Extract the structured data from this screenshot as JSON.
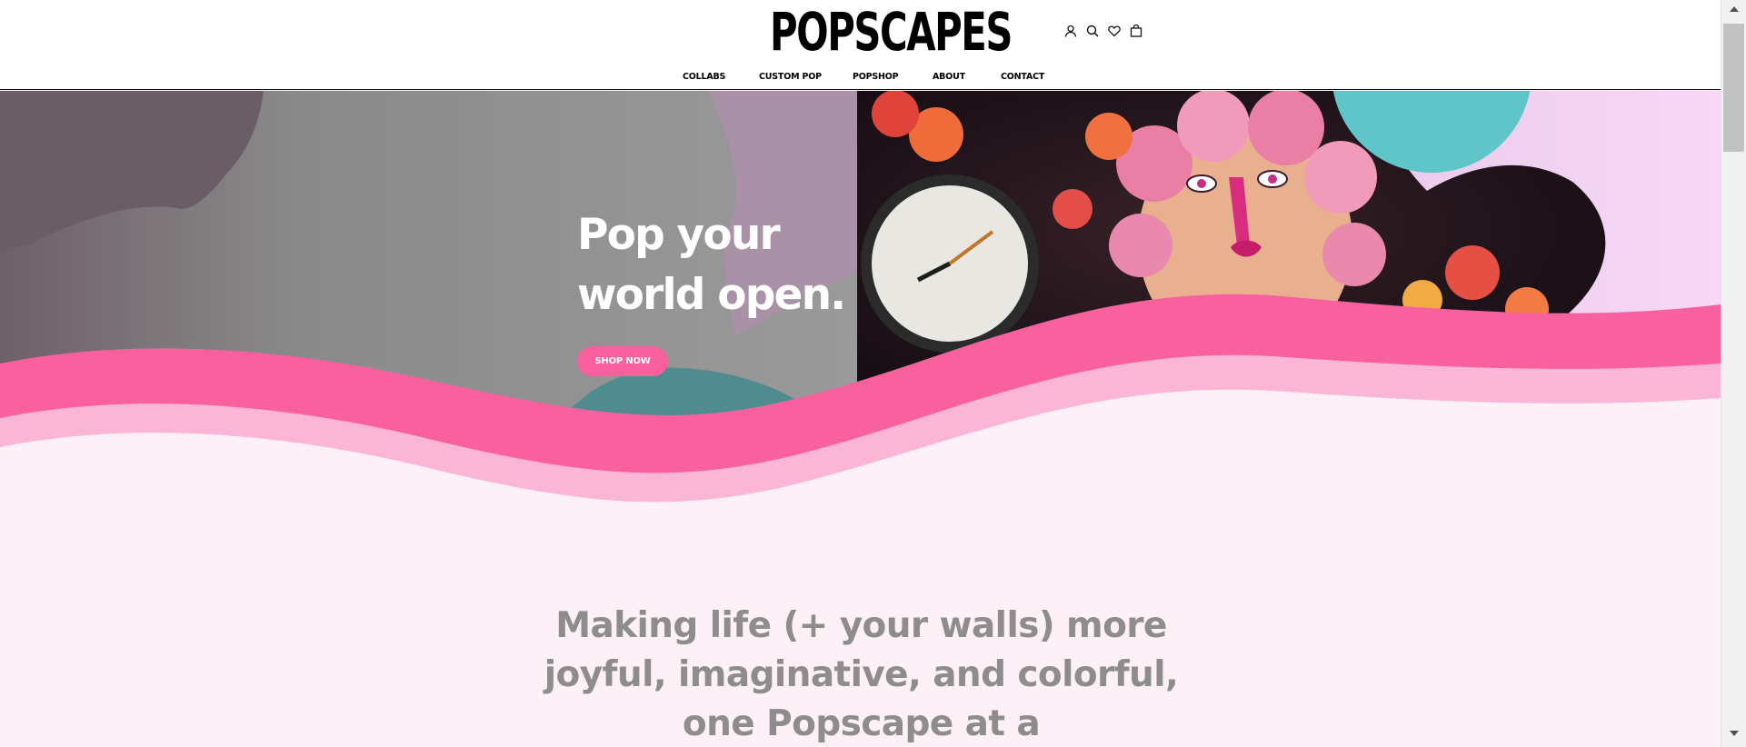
{
  "header": {
    "logo_text": "POPSCAPES",
    "icons": [
      "account-icon",
      "search-icon",
      "wishlist-heart-icon",
      "cart-bag-icon"
    ]
  },
  "nav": {
    "items": [
      {
        "label": "COLLABS"
      },
      {
        "label": "CUSTOM POP"
      },
      {
        "label": "POPSHOP"
      },
      {
        "label": "ABOUT"
      },
      {
        "label": "CONTACT"
      }
    ]
  },
  "hero": {
    "title_line1": "Pop your",
    "title_line2": "world open.",
    "cta_label": "SHOP NOW"
  },
  "intro": {
    "tagline": "Making life (+ your walls) more joyful, imaginative, and colorful, one Popscape at a"
  },
  "colors": {
    "brand_pink": "#f9609e",
    "light_pink": "#fbb6d5",
    "page_background": "#fdf1f7",
    "teal": "#4f8b8f",
    "tagline_gray": "#8f8c8e"
  }
}
